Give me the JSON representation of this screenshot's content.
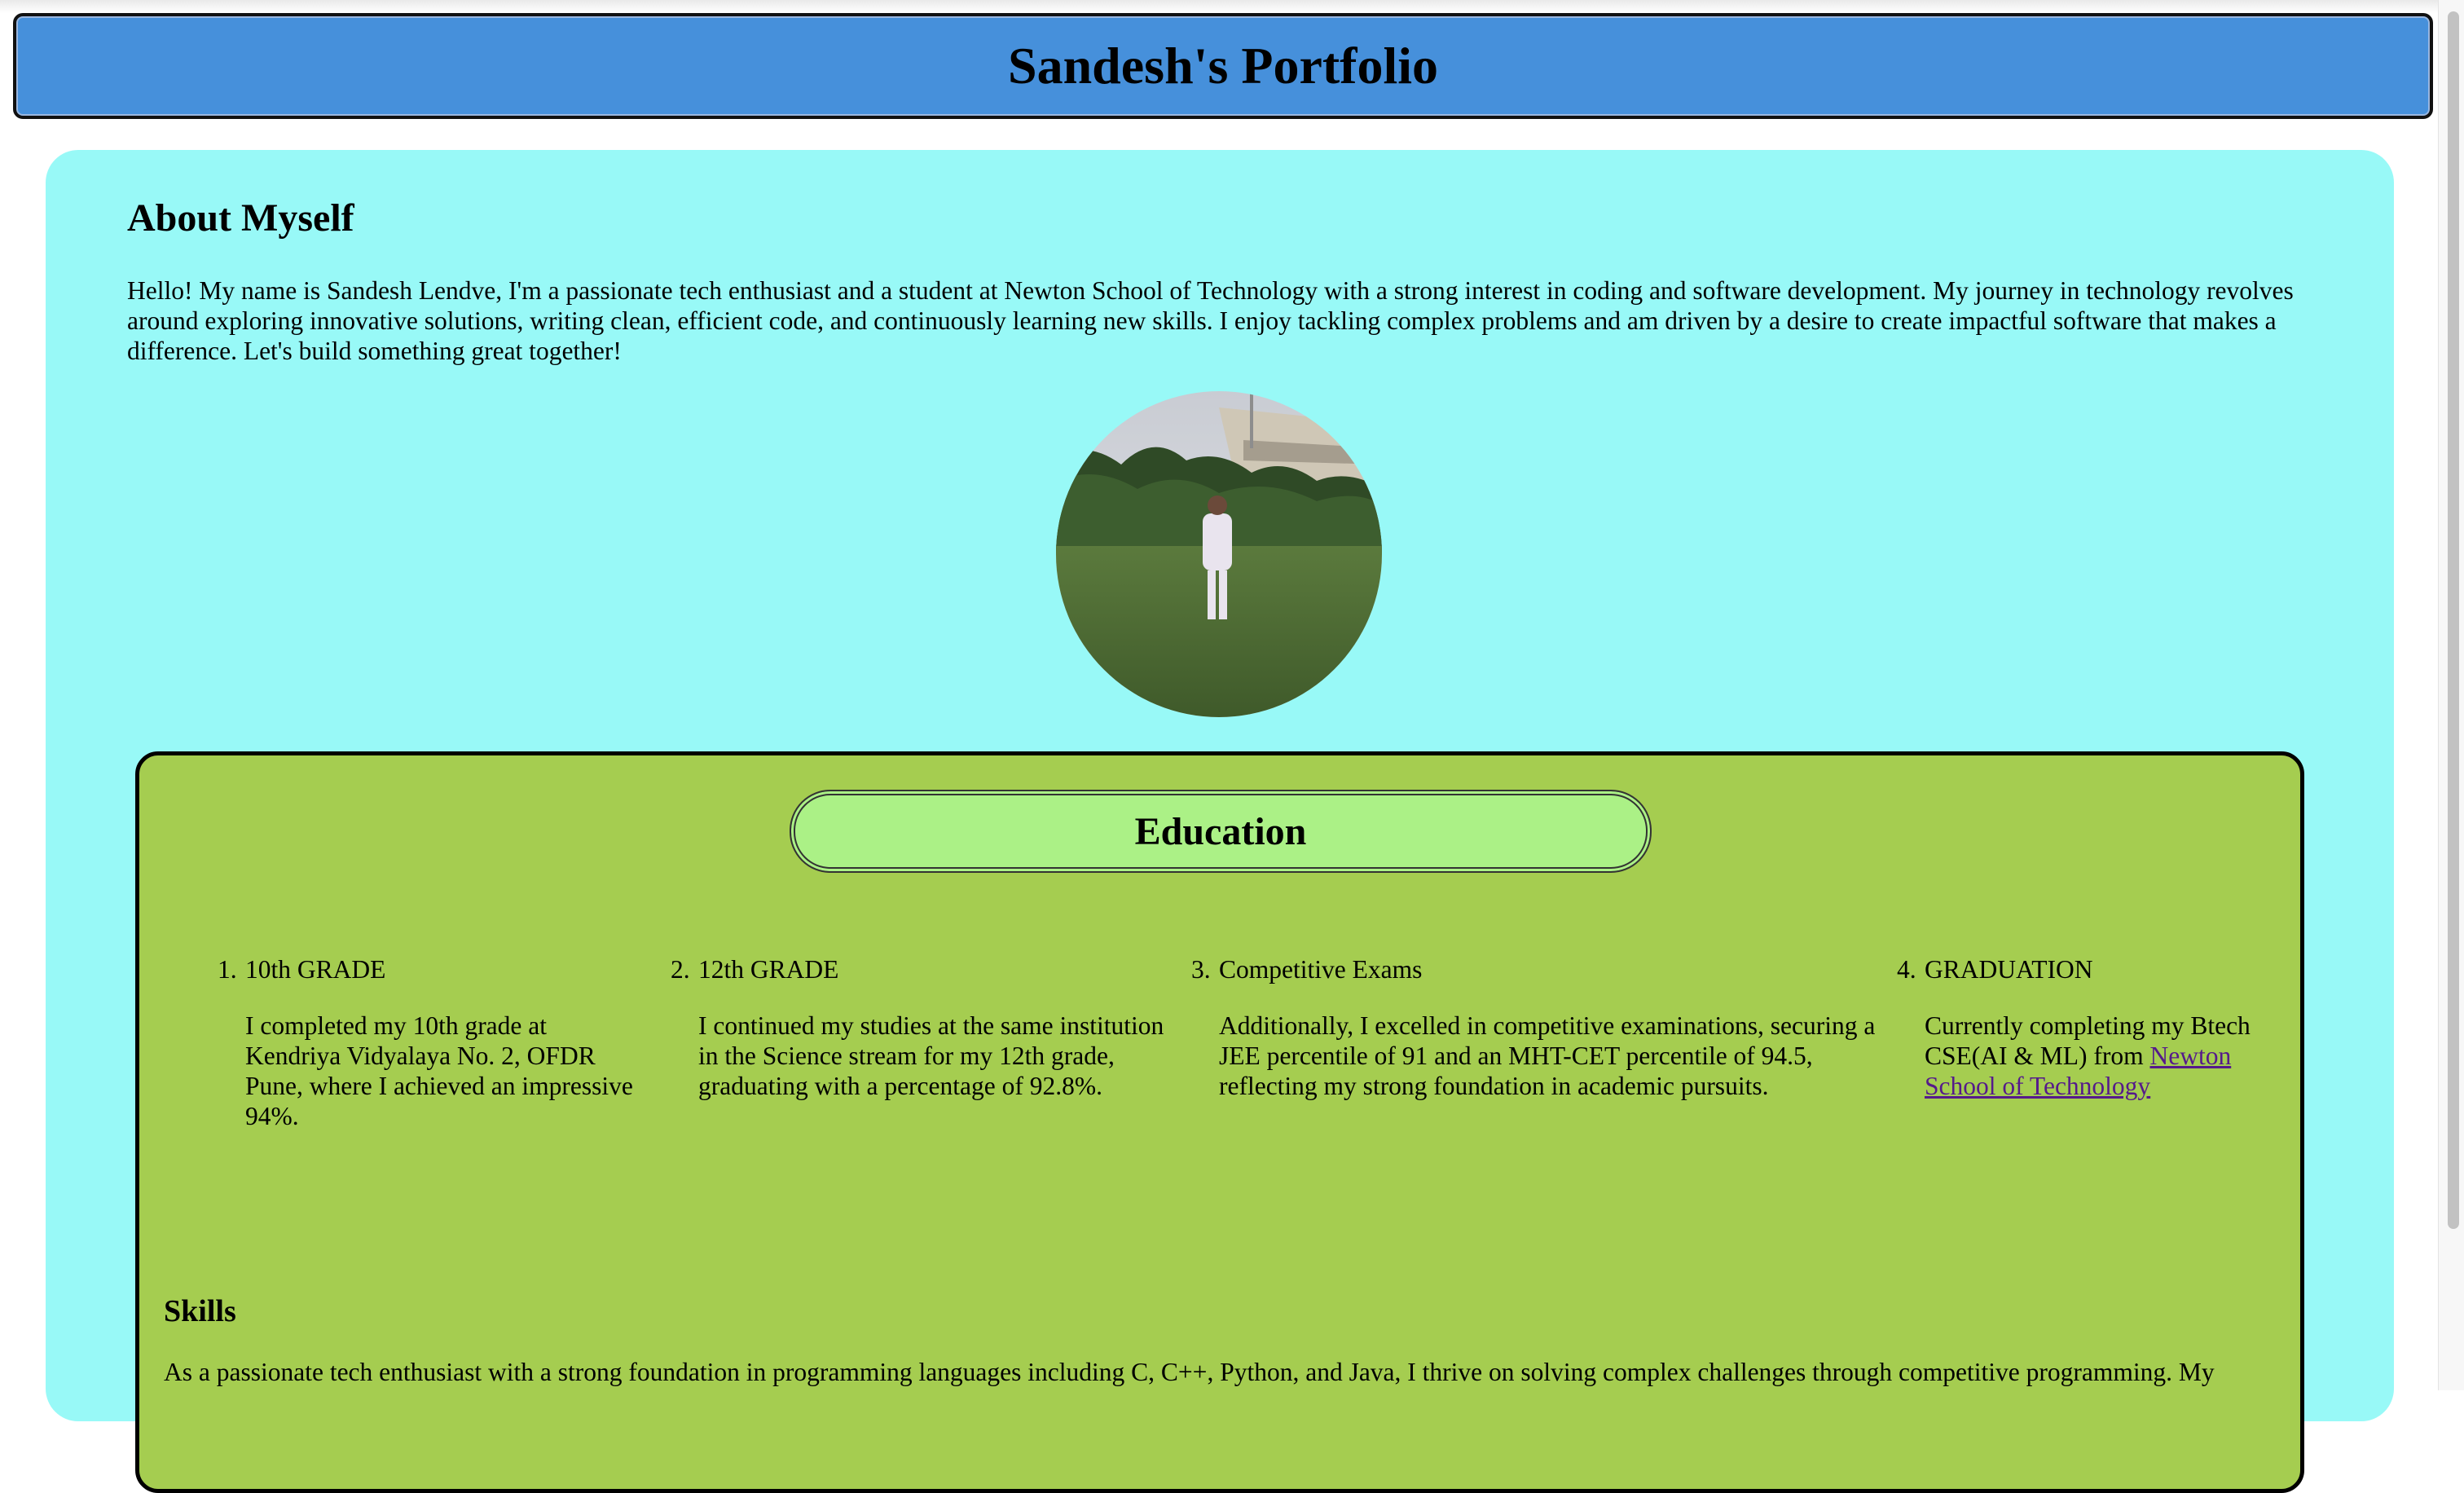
{
  "header": {
    "title": "Sandesh's Portfolio"
  },
  "about": {
    "title": "About Myself",
    "text": "Hello! My name is Sandesh Lendve, I'm a passionate tech enthusiast and a student at Newton School of Technology with a strong interest in coding and software development. My journey in technology revolves around exploring innovative solutions, writing clean, efficient code, and continuously learning new skills. I enjoy tackling complex problems and am driven by a desire to create impactful software that makes a difference. Let's build something great together!"
  },
  "education": {
    "title": "Education",
    "items": [
      {
        "number": "1.",
        "heading": "10th GRADE",
        "description": "I completed my 10th grade at Kendriya Vidyalaya No. 2, OFDR Pune, where I achieved an impressive 94%."
      },
      {
        "number": "2.",
        "heading": "12th GRADE",
        "description": "I continued my studies at the same institution in the Science stream for my 12th grade, graduating with a percentage of 92.8%."
      },
      {
        "number": "3.",
        "heading": "Competitive Exams",
        "description": "Additionally, I excelled in competitive examinations, securing a JEE percentile of 91 and an MHT-CET percentile of 94.5, reflecting my strong foundation in academic pursuits."
      },
      {
        "number": "4.",
        "heading": "GRADUATION",
        "description": "Currently completing my Btech CSE(AI & ML) from",
        "link": "Newton School of Technology"
      }
    ]
  },
  "skills": {
    "title": "Skills",
    "text": "As a passionate tech enthusiast with a strong foundation in programming languages including C, C++, Python, and Java, I thrive on solving complex challenges through competitive programming. My"
  },
  "colors": {
    "header_bg": "#4690db",
    "about_bg": "#98f9f7",
    "education_bg": "#a5cd50",
    "education_pill_bg": "#abf186",
    "link": "#551a8b"
  }
}
